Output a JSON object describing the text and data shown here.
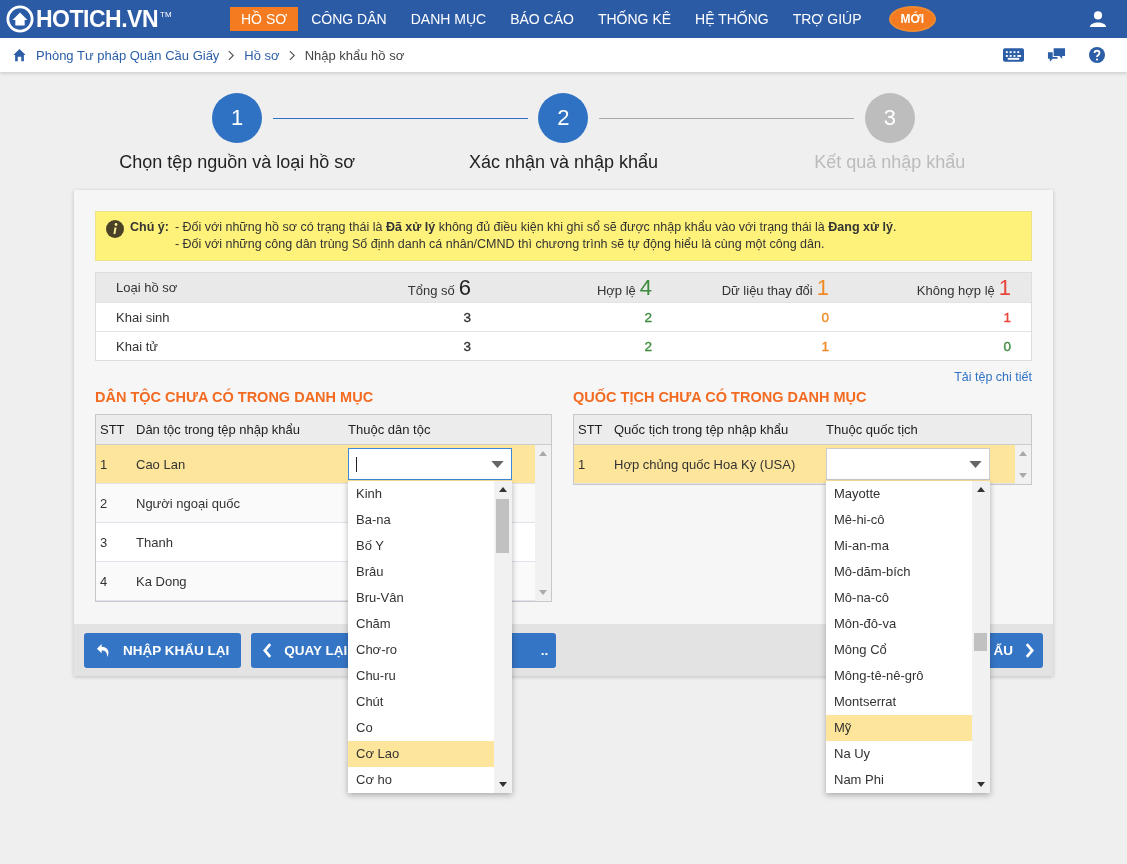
{
  "nav": {
    "logo": "HOTICH.VN",
    "trademark": "TM",
    "menu": [
      {
        "label": "HỒ SƠ",
        "selected": true
      },
      {
        "label": "CÔNG DÂN",
        "selected": false
      },
      {
        "label": "DANH MỤC",
        "selected": false
      },
      {
        "label": "BÁO CÁO",
        "selected": false
      },
      {
        "label": "THỐNG KÊ",
        "selected": false
      },
      {
        "label": "HỆ THỐNG",
        "selected": false
      },
      {
        "label": "TRỢ GIÚP",
        "selected": false
      }
    ],
    "badge": "MỚI"
  },
  "breadcrumb": [
    {
      "label": "Phòng Tư pháp Quận Cầu Giấy",
      "current": false
    },
    {
      "label": "Hồ sơ",
      "current": false
    },
    {
      "label": "Nhập khẩu hồ sơ",
      "current": true
    }
  ],
  "steps": [
    {
      "number": "1",
      "label": "Chọn tệp nguồn và loại hồ sơ",
      "active": true
    },
    {
      "number": "2",
      "label": "Xác nhận và nhập khẩu",
      "active": true
    },
    {
      "number": "3",
      "label": "Kết quả nhập khẩu",
      "active": false
    }
  ],
  "notice": {
    "title": "Chú ý:",
    "lines": [
      "- Đối với những hồ sơ có trạng thái là **Đã xử lý** không đủ điều kiện khi ghi sổ sẽ được nhập khẩu vào với trạng thái là **Đang xử lý**.",
      "- Đối với những công dân trùng Số định danh cá nhân/CMND thì chương trình sẽ tự động hiểu là cùng một công dân."
    ]
  },
  "summary": {
    "columns": [
      {
        "label": "Loại hồ sơ"
      },
      {
        "label": "Tổng số",
        "total": "6",
        "color": "#222222"
      },
      {
        "label": "Hợp lệ",
        "total": "4",
        "color": "#3d8b3d"
      },
      {
        "label": "Dữ liệu thay đổi",
        "total": "1",
        "color": "#f08a24"
      },
      {
        "label": "Không hợp lệ",
        "total": "1",
        "color": "#e8453c"
      }
    ],
    "rows": [
      {
        "cells": [
          {
            "text": "Khai sinh"
          },
          {
            "text": "3",
            "color": "#333333"
          },
          {
            "text": "2",
            "color": "#3d8b3d"
          },
          {
            "text": "0",
            "color": "#f08a24"
          },
          {
            "text": "1",
            "color": "#e8453c"
          }
        ]
      },
      {
        "cells": [
          {
            "text": "Khai tử"
          },
          {
            "text": "3",
            "color": "#333333"
          },
          {
            "text": "2",
            "color": "#3d8b3d"
          },
          {
            "text": "1",
            "color": "#f08a24"
          },
          {
            "text": "0",
            "color": "#3d8b3d"
          }
        ]
      }
    ]
  },
  "download_link": "Tải tệp chi tiết",
  "sections": [
    {
      "title": "DÂN TỘC CHƯA CÓ TRONG DANH MỤC",
      "columns": [
        "STT",
        "Dân tộc trong tệp nhập khẩu",
        "Thuộc dân tộc"
      ],
      "rows": [
        {
          "stt": "1",
          "name": "Cao Lan",
          "selected": true
        },
        {
          "stt": "2",
          "name": "Người ngoại quốc",
          "selected": false
        },
        {
          "stt": "3",
          "name": "Thanh",
          "selected": false
        },
        {
          "stt": "4",
          "name": "Ka Dong",
          "selected": false
        }
      ],
      "select": {
        "focused": true,
        "options": [
          {
            "label": "Kinh",
            "selected": false
          },
          {
            "label": "Ba-na",
            "selected": false
          },
          {
            "label": "Bố Y",
            "selected": false
          },
          {
            "label": "Brâu",
            "selected": false
          },
          {
            "label": "Bru-Vân",
            "selected": false
          },
          {
            "label": "Chăm",
            "selected": false
          },
          {
            "label": "Chơ-ro",
            "selected": false
          },
          {
            "label": "Chu-ru",
            "selected": false
          },
          {
            "label": "Chút",
            "selected": false
          },
          {
            "label": "Co",
            "selected": false
          },
          {
            "label": "Cơ Lao",
            "selected": true
          },
          {
            "label": "Cơ ho",
            "selected": false
          }
        ]
      }
    },
    {
      "title": "QUỐC TỊCH CHƯA CÓ TRONG DANH MỤC",
      "columns": [
        "STT",
        "Quốc tịch trong tệp nhập khẩu",
        "Thuộc quốc tịch"
      ],
      "rows": [
        {
          "stt": "1",
          "name": "Hợp chủng quốc Hoa Kỳ (USA)",
          "selected": true
        }
      ],
      "select": {
        "focused": false,
        "options": [
          {
            "label": "Mayotte",
            "selected": false
          },
          {
            "label": "Mê-hi-cô",
            "selected": false
          },
          {
            "label": "Mi-an-ma",
            "selected": false
          },
          {
            "label": "Mô-dăm-bích",
            "selected": false
          },
          {
            "label": "Mô-na-cô",
            "selected": false
          },
          {
            "label": "Môn-đô-va",
            "selected": false
          },
          {
            "label": "Mông Cổ",
            "selected": false
          },
          {
            "label": "Mông-tê-nê-grô",
            "selected": false
          },
          {
            "label": "Montserrat",
            "selected": false
          },
          {
            "label": "Mỹ",
            "selected": true
          },
          {
            "label": "Na Uy",
            "selected": false
          },
          {
            "label": "Nam Phi",
            "selected": false
          }
        ]
      }
    }
  ],
  "buttons": [
    {
      "label": "NHẬP KHẨU LẠI",
      "kind": "undo"
    },
    {
      "label": "QUAY LẠI",
      "kind": "back"
    },
    {
      "label": "..",
      "kind": "plain"
    },
    {
      "label": "ẨU",
      "kind": "next"
    }
  ]
}
